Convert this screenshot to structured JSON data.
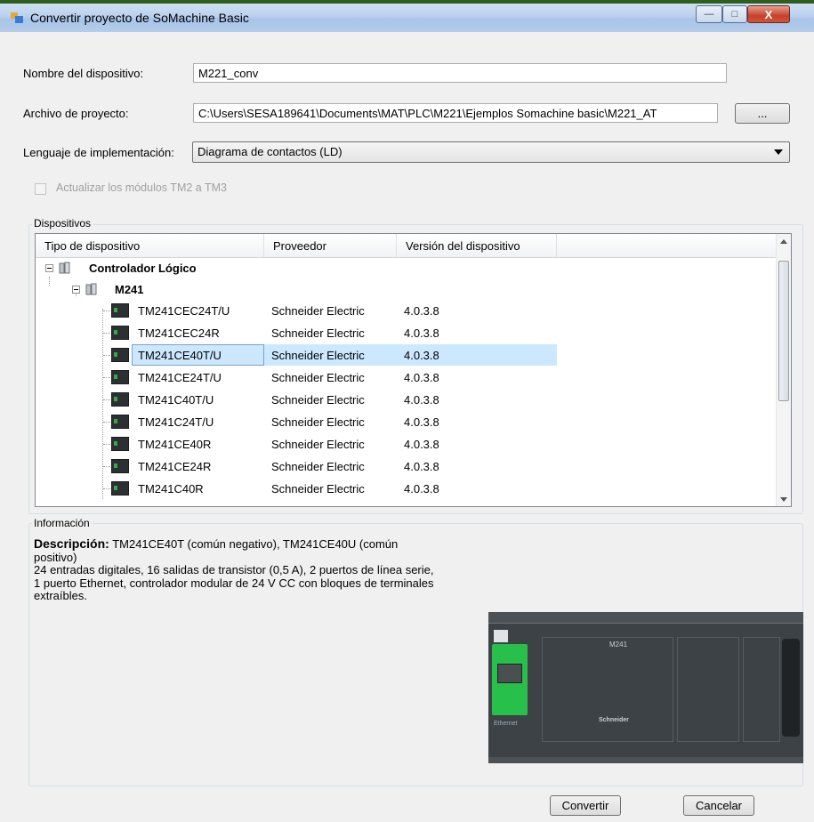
{
  "window": {
    "title": "Convertir proyecto de SoMachine Basic",
    "buttons": {
      "minimize": "—",
      "maximize": "□",
      "close": "X"
    }
  },
  "form": {
    "device_name_label": "Nombre del dispositivo:",
    "device_name_value": "M221_conv",
    "project_file_label": "Archivo de proyecto:",
    "project_file_value": "C:\\Users\\SESA189641\\Documents\\MAT\\PLC\\M221\\Ejemplos Somachine basic\\M221_AT",
    "browse_label": "...",
    "language_label": "Lenguaje de implementación:",
    "language_value": "Diagrama de contactos (LD)",
    "update_modules_label": "Actualizar los módulos TM2 a TM3",
    "update_modules_checked": false
  },
  "devices": {
    "group_title": "Dispositivos",
    "columns": [
      "Tipo de dispositivo",
      "Proveedor",
      "Versión del dispositivo"
    ],
    "root": "Controlador Lógico",
    "family": "M241",
    "rows": [
      {
        "type": "TM241CEC24T/U",
        "vendor": "Schneider Electric",
        "version": "4.0.3.8"
      },
      {
        "type": "TM241CEC24R",
        "vendor": "Schneider Electric",
        "version": "4.0.3.8"
      },
      {
        "type": "TM241CE40T/U",
        "vendor": "Schneider Electric",
        "version": "4.0.3.8"
      },
      {
        "type": "TM241CE24T/U",
        "vendor": "Schneider Electric",
        "version": "4.0.3.8"
      },
      {
        "type": "TM241C40T/U",
        "vendor": "Schneider Electric",
        "version": "4.0.3.8"
      },
      {
        "type": "TM241C24T/U",
        "vendor": "Schneider Electric",
        "version": "4.0.3.8"
      },
      {
        "type": "TM241CE40R",
        "vendor": "Schneider Electric",
        "version": "4.0.3.8"
      },
      {
        "type": "TM241CE24R",
        "vendor": "Schneider Electric",
        "version": "4.0.3.8"
      },
      {
        "type": "TM241C40R",
        "vendor": "Schneider Electric",
        "version": "4.0.3.8"
      }
    ],
    "selected_index": 2
  },
  "info": {
    "group_title": "Información",
    "description_label": "Descripción:",
    "description_title": "TM241CE40T (común negativo), TM241CE40U (común",
    "description_title_2": "positivo)",
    "lines": [
      "24 entradas digitales, 16 salidas de transistor (0,5 A), 2 puertos de línea serie,",
      "1 puerto Ethernet, controlador modular de 24 V CC con bloques de terminales",
      "extraíbles."
    ],
    "image_labels": {
      "model": "M241",
      "brand": "Schneider",
      "port": "Ethernet"
    }
  },
  "footer": {
    "convert_label": "Convertir",
    "cancel_label": "Cancelar"
  },
  "colors": {
    "selection": "#cce8ff",
    "selection_border": "#7da2ce",
    "titlebar": "#b9d1ee"
  }
}
